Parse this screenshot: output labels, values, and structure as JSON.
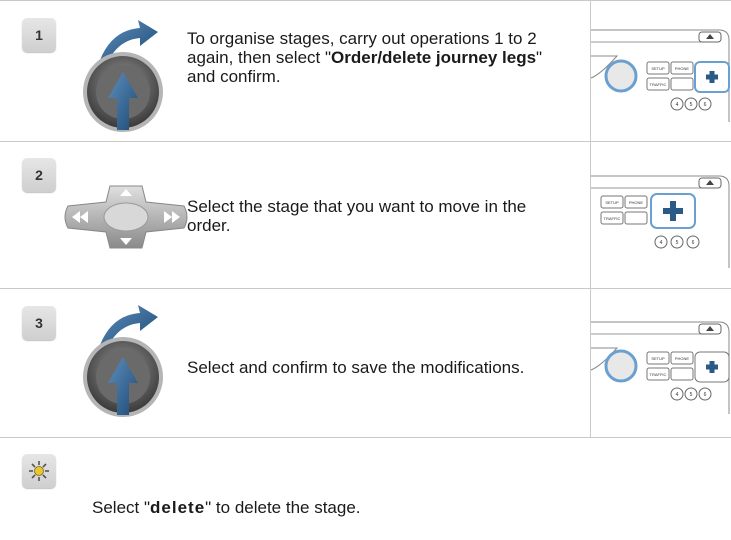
{
  "steps": [
    {
      "number": "1",
      "icon": "rotary-knob-press-icon",
      "text_pre": "To organise stages, carry out operations 1 to 2 again, then select \"",
      "text_bold": "Order/delete journey legs",
      "text_post": "\" and confirm.",
      "panel_labels": {
        "setup": "SETUP",
        "phone": "PHONE",
        "traffic": "TRAFFIC",
        "b4": "4",
        "b5": "5",
        "b6": "6"
      }
    },
    {
      "number": "2",
      "icon": "directional-pad-icon",
      "text": "Select the stage that you want to move in the order.",
      "panel_labels": {
        "setup": "SETUP",
        "phone": "PHONE",
        "traffic": "TRAFFIC",
        "b4": "4",
        "b5": "5",
        "b6": "6"
      }
    },
    {
      "number": "3",
      "icon": "rotary-knob-press-icon",
      "text": "Select and confirm to save the modifications.",
      "panel_labels": {
        "setup": "SETUP",
        "phone": "PHONE",
        "traffic": "TRAFFIC",
        "b4": "4",
        "b5": "5",
        "b6": "6"
      }
    }
  ],
  "note": {
    "icon": "tip-lightbulb-icon",
    "text_pre": "Select \"",
    "text_bold": "delete",
    "text_post": "\" to delete the stage."
  },
  "colors": {
    "knob_dark": "#3a3a3a",
    "arrow": "#2b5a86",
    "grid": "#c9c9c9",
    "badge": "#d8d8d8"
  }
}
